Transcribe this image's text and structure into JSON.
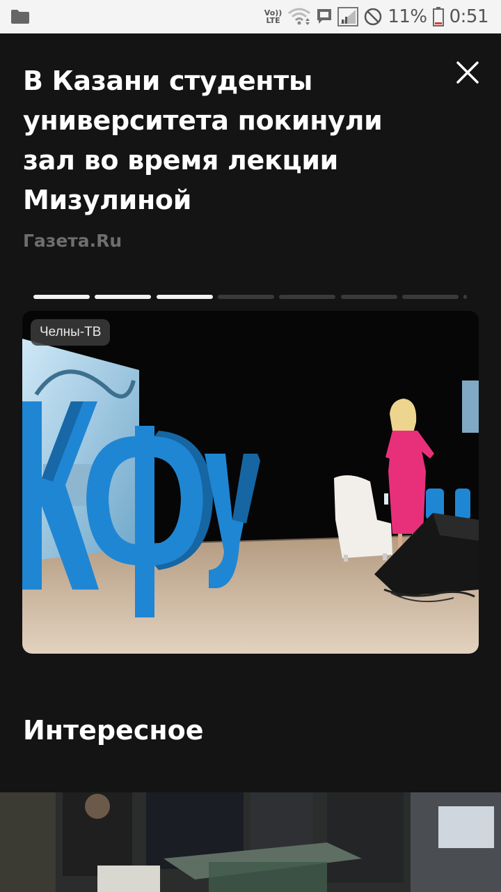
{
  "status_bar": {
    "volte_top": "Vo))",
    "volte_bottom": "LTE",
    "battery_percent": "11%",
    "time": "0:51"
  },
  "article": {
    "title": "В Казани студенты университета покинули зал во время лекции Мизулиной",
    "source": "Газета.Ru",
    "photo_credit": "Челны-ТВ",
    "stage_letters": "КФУ",
    "progress_total": 8,
    "progress_active": 3
  },
  "section": {
    "title": "Интересное"
  },
  "colors": {
    "background": "#141414",
    "accent_blue": "#1f86d4",
    "dress_pink": "#e8307a"
  }
}
